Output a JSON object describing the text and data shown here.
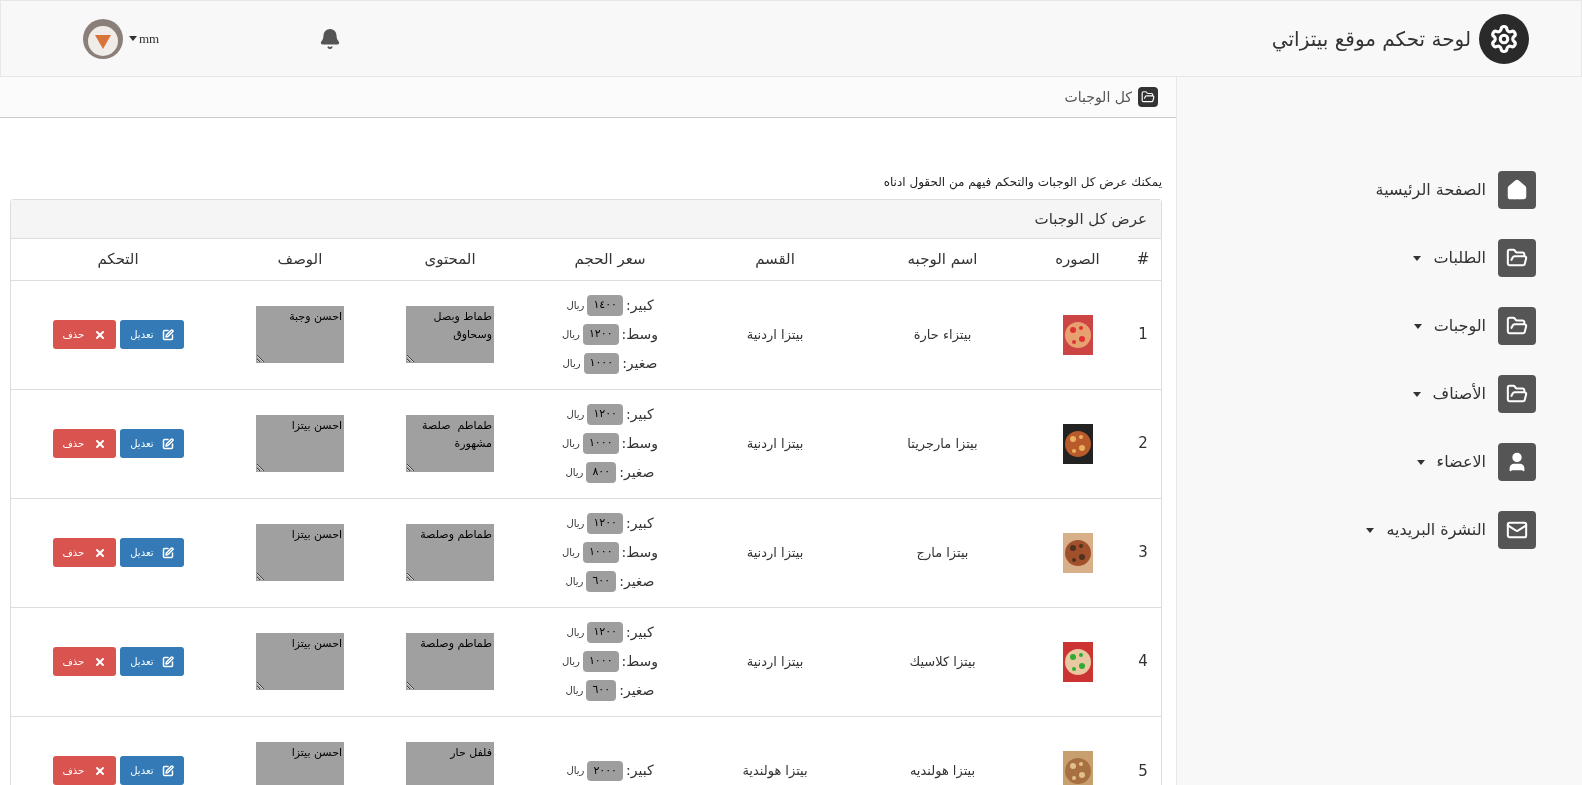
{
  "header": {
    "title": "لوحة تحكم موقع بيتزاتي",
    "user": {
      "name": "mm"
    }
  },
  "breadcrumb": {
    "title": "كل الوجبات"
  },
  "intro": "يمكنك عرض كل الوجبات والتحكم فيهم من الحقول ادناه",
  "panel": {
    "title": "عرض كل الوجبات",
    "columns": [
      "#",
      "الصوره",
      "اسم الوجبه",
      "القسم",
      "سعر الحجم",
      "المحتوى",
      "الوصف",
      "التحكم"
    ],
    "rows": [
      {
        "number": "1",
        "name": "بيتزاء حارة",
        "category": "بيتزا اردنية",
        "prices": [
          {
            "label": "كبير:",
            "amount": "١٤٠٠",
            "currency": "ريال"
          },
          {
            "label": "وسط:",
            "amount": "١٢٠٠",
            "currency": "ريال"
          },
          {
            "label": "صغير:",
            "amount": "١٠٠٠",
            "currency": "ريال"
          }
        ],
        "content": "طماط وبصل وسحاوق",
        "description": "احسن وجبة",
        "edit": "تعديل",
        "delete": "حذف"
      },
      {
        "number": "2",
        "name": "بيتزا مارجريتا",
        "category": "بيتزا اردنية",
        "prices": [
          {
            "label": "كبير:",
            "amount": "١٢٠٠",
            "currency": "ريال"
          },
          {
            "label": "وسط:",
            "amount": "١٠٠٠",
            "currency": "ريال"
          },
          {
            "label": "صغير:",
            "amount": "٨٠٠",
            "currency": "ريال"
          }
        ],
        "content": "طماطم  صلصة مشهورة",
        "description": "احسن بيتزا",
        "edit": "تعديل",
        "delete": "حذف"
      },
      {
        "number": "3",
        "name": "بيتزا مارج",
        "category": "بيتزا اردنية",
        "prices": [
          {
            "label": "كبير:",
            "amount": "١٢٠٠",
            "currency": "ريال"
          },
          {
            "label": "وسط:",
            "amount": "١٠٠٠",
            "currency": "ريال"
          },
          {
            "label": "صغير:",
            "amount": "٦٠٠",
            "currency": "ريال"
          }
        ],
        "content": "طماطم وصلصة",
        "description": "احسن بيتزا",
        "edit": "تعديل",
        "delete": "حذف"
      },
      {
        "number": "4",
        "name": "بيتزا كلاسيك",
        "category": "بيتزا اردنية",
        "prices": [
          {
            "label": "كبير:",
            "amount": "١٢٠٠",
            "currency": "ريال"
          },
          {
            "label": "وسط:",
            "amount": "١٠٠٠",
            "currency": "ريال"
          },
          {
            "label": "صغير:",
            "amount": "٦٠٠",
            "currency": "ريال"
          }
        ],
        "content": "طماطم وصلصة",
        "description": "احسن بيتزا",
        "edit": "تعديل",
        "delete": "حذف"
      },
      {
        "number": "5",
        "name": "بيتزا هولنديه",
        "category": "بيتزا هولندية",
        "prices": [
          {
            "label": "كبير:",
            "amount": "٢٠٠٠",
            "currency": "ريال"
          }
        ],
        "content": "فلفل حار",
        "description": "احسن بيتزا",
        "edit": "تعديل",
        "delete": "حذف"
      }
    ]
  },
  "sidebar": {
    "items": [
      {
        "label": "الصفحة الرئيسية",
        "kind": "home",
        "expandable": false
      },
      {
        "label": "الطلبات",
        "kind": "folder",
        "expandable": true
      },
      {
        "label": "الوجبات",
        "kind": "folder",
        "expandable": true
      },
      {
        "label": "الأصناف",
        "kind": "folder",
        "expandable": true
      },
      {
        "label": "الاعضاء",
        "kind": "user",
        "expandable": true
      },
      {
        "label": "النشرة البريديه",
        "kind": "mail",
        "expandable": true
      }
    ]
  }
}
